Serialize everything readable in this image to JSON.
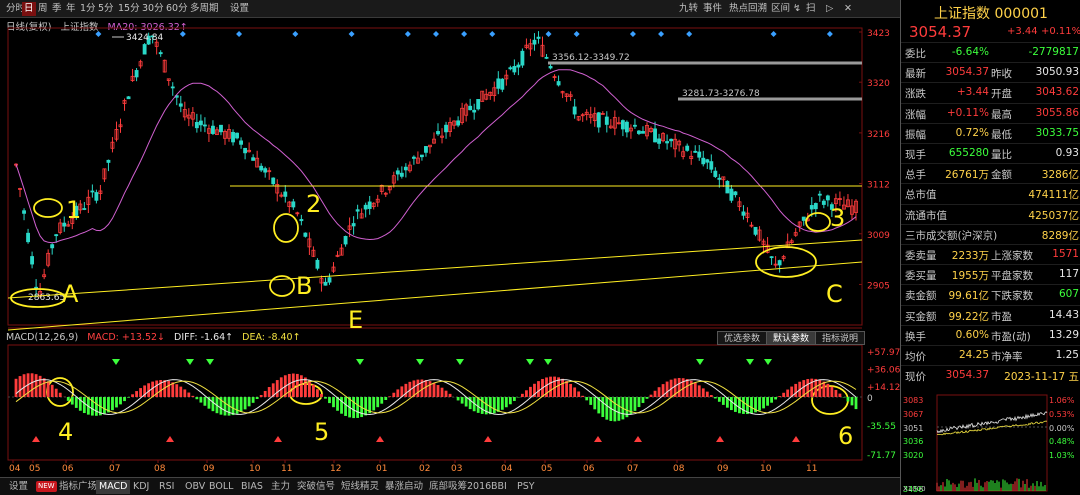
{
  "toolbar": {
    "left_items": [
      "分时",
      "日",
      "周",
      "季",
      "年",
      "1分",
      "5分",
      "15分",
      "30分",
      "60分",
      "多周期",
      "设置"
    ],
    "active": "日",
    "right_items": [
      "九转",
      "事件",
      "热点回溯",
      "区间",
      "↯",
      "扫",
      "▷",
      "✕"
    ]
  },
  "legend": {
    "main_label": "日线(复权)",
    "index_name": "上证指数",
    "ma_label": "MA20: 3026.32↑"
  },
  "price_axis": {
    "ticks": [
      "3423",
      "3320",
      "3216",
      "3112",
      "3009",
      "2905"
    ]
  },
  "annotations": {
    "high_label": "3424.84",
    "low_label": "2863.65",
    "gap1": "3356.12-3349.72",
    "gap2": "3281.73-3276.78",
    "hand_marks": [
      "1",
      "2",
      "3",
      "A",
      "B",
      "C",
      "E",
      "4",
      "5",
      "6"
    ]
  },
  "macd_panel": {
    "title": "MACD(12,26,9)",
    "macd": "MACD: +13.52↓",
    "diff": "DIFF: -1.64↑",
    "dea": "DEA: -8.40↑",
    "buttons": [
      "优选参数",
      "默认参数",
      "指标说明"
    ],
    "active_button": "默认参数",
    "ticks": [
      "+57.97",
      "+36.06",
      "+14.12",
      "0",
      "-35.55",
      "-71.77"
    ]
  },
  "date_axis": [
    "04",
    "05",
    "06",
    "07",
    "08",
    "09",
    "10",
    "11",
    "12",
    "01",
    "02",
    "03",
    "04",
    "05",
    "06",
    "07",
    "08",
    "09",
    "10",
    "11"
  ],
  "bottom_tabs": {
    "items": [
      "设置",
      "NEW",
      "指标广场",
      "MACD",
      "KDJ",
      "RSI",
      "OBV",
      "BOLL",
      "BIAS",
      "主力",
      "突破信号",
      "短线精灵",
      "暴涨启动",
      "底部吸筹2016",
      "BBI",
      "PSY"
    ],
    "active": "MACD"
  },
  "quote_panel": {
    "title": "上证指数 000001",
    "price": "3054.37",
    "change": "+3.44",
    "change_pct": "+0.11%",
    "rows": [
      {
        "l1": "委比",
        "v1": "-6.64%",
        "l2": "",
        "v2": "-2779817"
      },
      {
        "l1": "最新",
        "v1": "3054.37",
        "l2": "昨收",
        "v2": "3050.93"
      },
      {
        "l1": "涨跌",
        "v1": "+3.44",
        "l2": "开盘",
        "v2": "3043.62"
      },
      {
        "l1": "涨幅",
        "v1": "+0.11%",
        "l2": "最高",
        "v2": "3055.86"
      },
      {
        "l1": "振幅",
        "v1": "0.72%",
        "l2": "最低",
        "v2": "3033.75"
      },
      {
        "l1": "现手",
        "v1": "655280",
        "l2": "量比",
        "v2": "0.93"
      },
      {
        "l1": "总手",
        "v1": "26761万",
        "l2": "金额",
        "v2": "3286亿"
      },
      {
        "l1": "总市值",
        "v1": "",
        "l2": "",
        "v2": "474111亿"
      },
      {
        "l1": "流通市值",
        "v1": "",
        "l2": "",
        "v2": "425037亿"
      },
      {
        "l1": "三市成交额(沪深京)",
        "v1": "",
        "l2": "",
        "v2": "8289亿"
      },
      {
        "l1": "委卖量",
        "v1": "2233万",
        "l2": "上涨家数",
        "v2": "1571"
      },
      {
        "l1": "委买量",
        "v1": "1955万",
        "l2": "平盘家数",
        "v2": "117"
      },
      {
        "l1": "卖金额",
        "v1": "99.61亿",
        "l2": "下跌家数",
        "v2": "607"
      },
      {
        "l1": "买金额",
        "v1": "99.22亿",
        "l2": "市盈",
        "v2": "14.43"
      },
      {
        "l1": "换手",
        "v1": "0.60%",
        "l2": "市盈(动)",
        "v2": "13.29"
      },
      {
        "l1": "均价",
        "v1": "24.25",
        "l2": "市净率",
        "v2": "1.25"
      },
      {
        "l1": "现价",
        "v1": "3054.37",
        "l2": "",
        "v2": "2023-11-17 五"
      }
    ]
  },
  "mini_chart": {
    "left_ticks": [
      "3083",
      "3067",
      "3051",
      "3036",
      "3020",
      "3456"
    ],
    "right_ticks": [
      "1.06%",
      "0.53%",
      "0.00%",
      "0.48%",
      "1.03%"
    ],
    "volume_label": "X1000"
  },
  "colors": {
    "up": "#ff3c3c",
    "down": "#2ad8c8",
    "ma": "#d060d0",
    "mark": "#ffee22",
    "gain": "#ff3c3c",
    "loss": "#3cff3c"
  }
}
